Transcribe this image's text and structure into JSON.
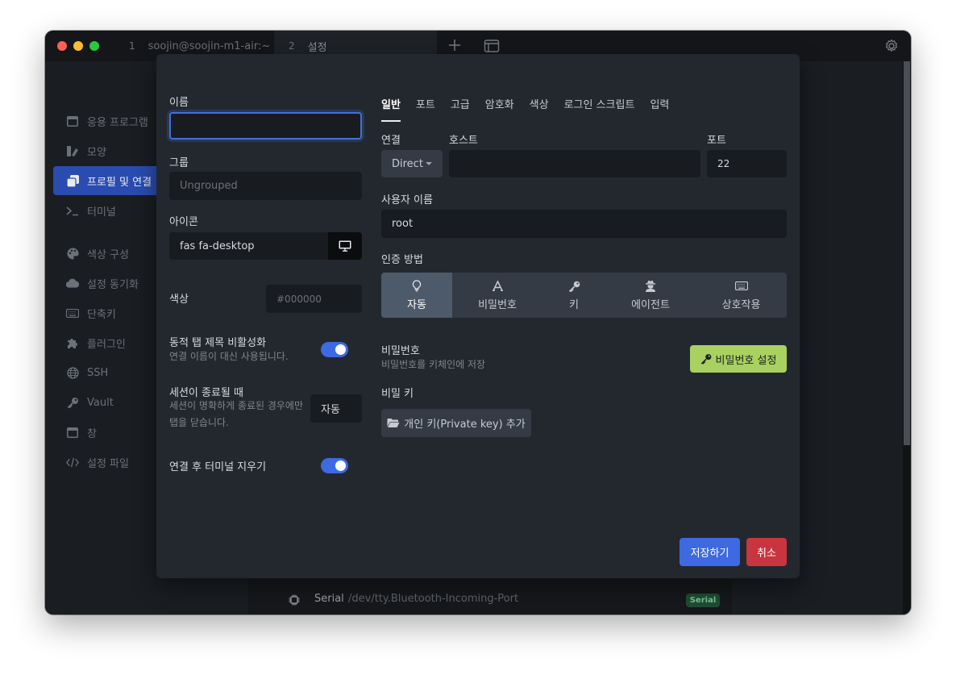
{
  "titlebar": {
    "tabs": [
      {
        "number": "1",
        "title": "soojin@soojin-m1-air:~"
      },
      {
        "number": "2",
        "title": "설정"
      }
    ],
    "new_tab_icon": "plus-icon",
    "window_icon": "window-icon",
    "settings_icon": "gear-icon"
  },
  "sidebar": {
    "items": [
      {
        "label": "응용 프로그램",
        "icon": "window-icon"
      },
      {
        "label": "모양",
        "icon": "palette-bar-icon"
      },
      {
        "label": "프로필 및 연결",
        "icon": "copy-icon",
        "active": true
      },
      {
        "label": "터미널",
        "icon": "terminal-icon"
      },
      {
        "label": "색상 구성",
        "icon": "palette-icon"
      },
      {
        "label": "설정 동기화",
        "icon": "cloud-icon"
      },
      {
        "label": "단축키",
        "icon": "keyboard-icon"
      },
      {
        "label": "플러그인",
        "icon": "puzzle-icon"
      },
      {
        "label": "SSH",
        "icon": "globe-icon"
      },
      {
        "label": "Vault",
        "icon": "key-icon"
      },
      {
        "label": "창",
        "icon": "window-icon"
      },
      {
        "label": "설정 파일",
        "icon": "code-icon"
      }
    ]
  },
  "background": {
    "serial_name": "Serial",
    "serial_path": "/dev/tty.Bluetooth-Incoming-Port",
    "serial_badge": "Serial"
  },
  "modal": {
    "left": {
      "name_label": "이름",
      "name_value": "",
      "group_label": "그룹",
      "group_placeholder": "Ungrouped",
      "icon_label": "아이콘",
      "icon_value": "fas fa-desktop",
      "color_label": "색상",
      "color_placeholder": "#000000",
      "dynamic_title_label": "동적 탭 제목 비활성화",
      "dynamic_title_sub": "연결 이름이 대신 사용됩니다.",
      "dynamic_title_on": true,
      "on_close_label": "세션이 종료될 때",
      "on_close_sub": "세션이 명확하게 종료된 경우에만 탭을 닫습니다.",
      "on_close_value": "자동",
      "clear_label": "연결 후 터미널 지우기",
      "clear_on": true
    },
    "tabs": [
      "일반",
      "포트",
      "고급",
      "암호화",
      "색상",
      "로그인 스크립트",
      "입력"
    ],
    "active_tab": 0,
    "general": {
      "connection_label": "연결",
      "connection_value": "Direct",
      "host_label": "호스트",
      "host_value": "",
      "port_label": "포트",
      "port_value": "22",
      "username_label": "사용자 이름",
      "username_value": "root",
      "auth_label": "인증 방법",
      "auth_methods": [
        {
          "label": "자동",
          "icon": "lightbulb-icon"
        },
        {
          "label": "비밀번호",
          "icon": "font-icon"
        },
        {
          "label": "키",
          "icon": "key-icon"
        },
        {
          "label": "에이전트",
          "icon": "user-secret-icon"
        },
        {
          "label": "상호작용",
          "icon": "keyboard-icon"
        }
      ],
      "auth_selected": 0,
      "password_label": "비밀번호",
      "password_sub": "비밀번호를 키체인에 저장",
      "set_password_button": "비밀번호 설정",
      "private_key_label": "비밀 키",
      "add_private_key_button": "개인 키(Private key) 추가"
    },
    "save_button": "저장하기",
    "cancel_button": "취소"
  },
  "colors": {
    "accent": "#3d6ae0",
    "set_password": "#a8d15f",
    "cancel": "#c9353f",
    "modal_bg": "#23282f"
  }
}
